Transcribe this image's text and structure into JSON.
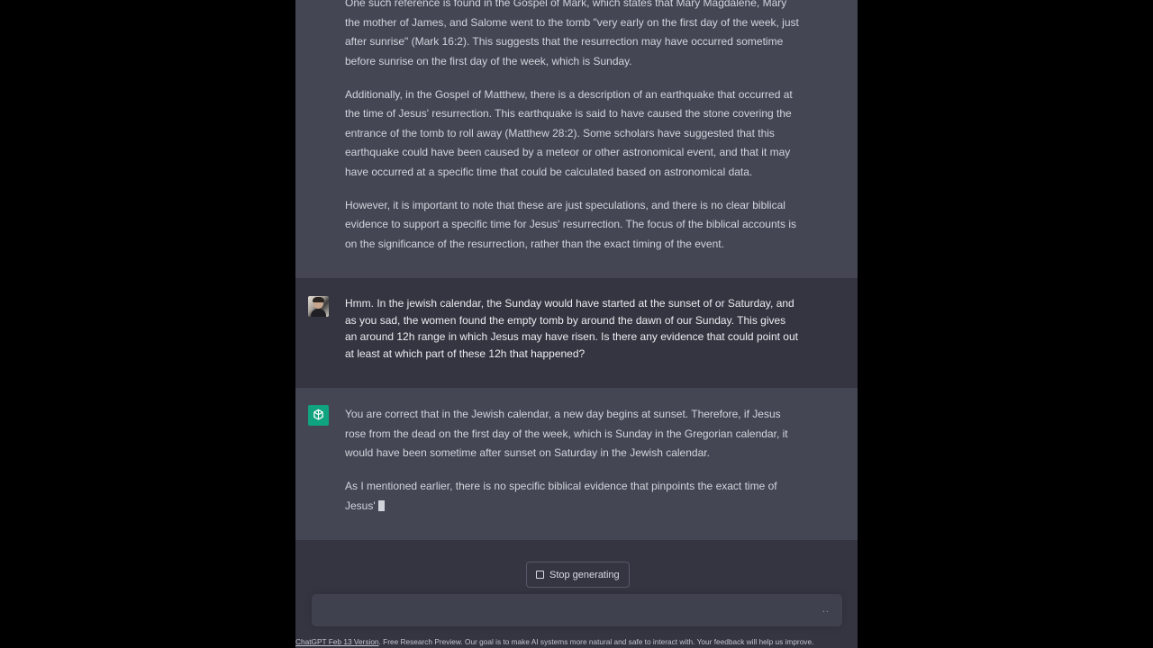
{
  "conversation": [
    {
      "role": "assistant",
      "paragraphs": [
        "One such reference is found in the Gospel of Mark, which states that Mary Magdalene, Mary the mother of James, and Salome went to the tomb \"very early on the first day of the week, just after sunrise\" (Mark 16:2). This suggests that the resurrection may have occurred sometime before sunrise on the first day of the week, which is Sunday.",
        "Additionally, in the Gospel of Matthew, there is a description of an earthquake that occurred at the time of Jesus' resurrection. This earthquake is said to have caused the stone covering the entrance of the tomb to roll away (Matthew 28:2). Some scholars have suggested that this earthquake could have been caused by a meteor or other astronomical event, and that it may have occurred at a specific time that could be calculated based on astronomical data.",
        "However, it is important to note that these are just speculations, and there is no clear biblical evidence to support a specific time for Jesus' resurrection. The focus of the biblical accounts is on the significance of the resurrection, rather than the exact timing of the event."
      ]
    },
    {
      "role": "user",
      "paragraphs": [
        "Hmm. In the jewish calendar, the Sunday would have started at the sunset of or Saturday, and as you sad, the women found the empty tomb by around the dawn of our Sunday. This gives an around 12h range in which Jesus may have risen. Is there any evidence that could point out at least at which part of these 12h that happened?"
      ]
    },
    {
      "role": "assistant",
      "paragraphs": [
        "You are correct that in the Jewish calendar, a new day begins at sunset. Therefore, if Jesus rose from the dead on the first day of the week, which is Sunday in the Gregorian calendar, it would have been sometime after sunset on Saturday in the Jewish calendar.",
        "As I mentioned earlier, there is no specific biblical evidence that pinpoints the exact time of Jesus'"
      ]
    }
  ],
  "controls": {
    "stop_label": "Stop generating",
    "composer_value": "",
    "send_indicator": ".."
  },
  "footer": {
    "link_text": "ChatGPT Feb 13 Version",
    "text": ". Free Research Preview. Our goal is to make AI systems more natural and safe to interact with. Your feedback will help us improve."
  },
  "icons": {
    "user_avatar": "user-photo-avatar",
    "assistant_avatar": "openai-logo-icon",
    "stop": "stop-square-icon"
  },
  "colors": {
    "assistant_bg": "#444654",
    "user_bg": "#343541",
    "brand": "#10a37f"
  }
}
